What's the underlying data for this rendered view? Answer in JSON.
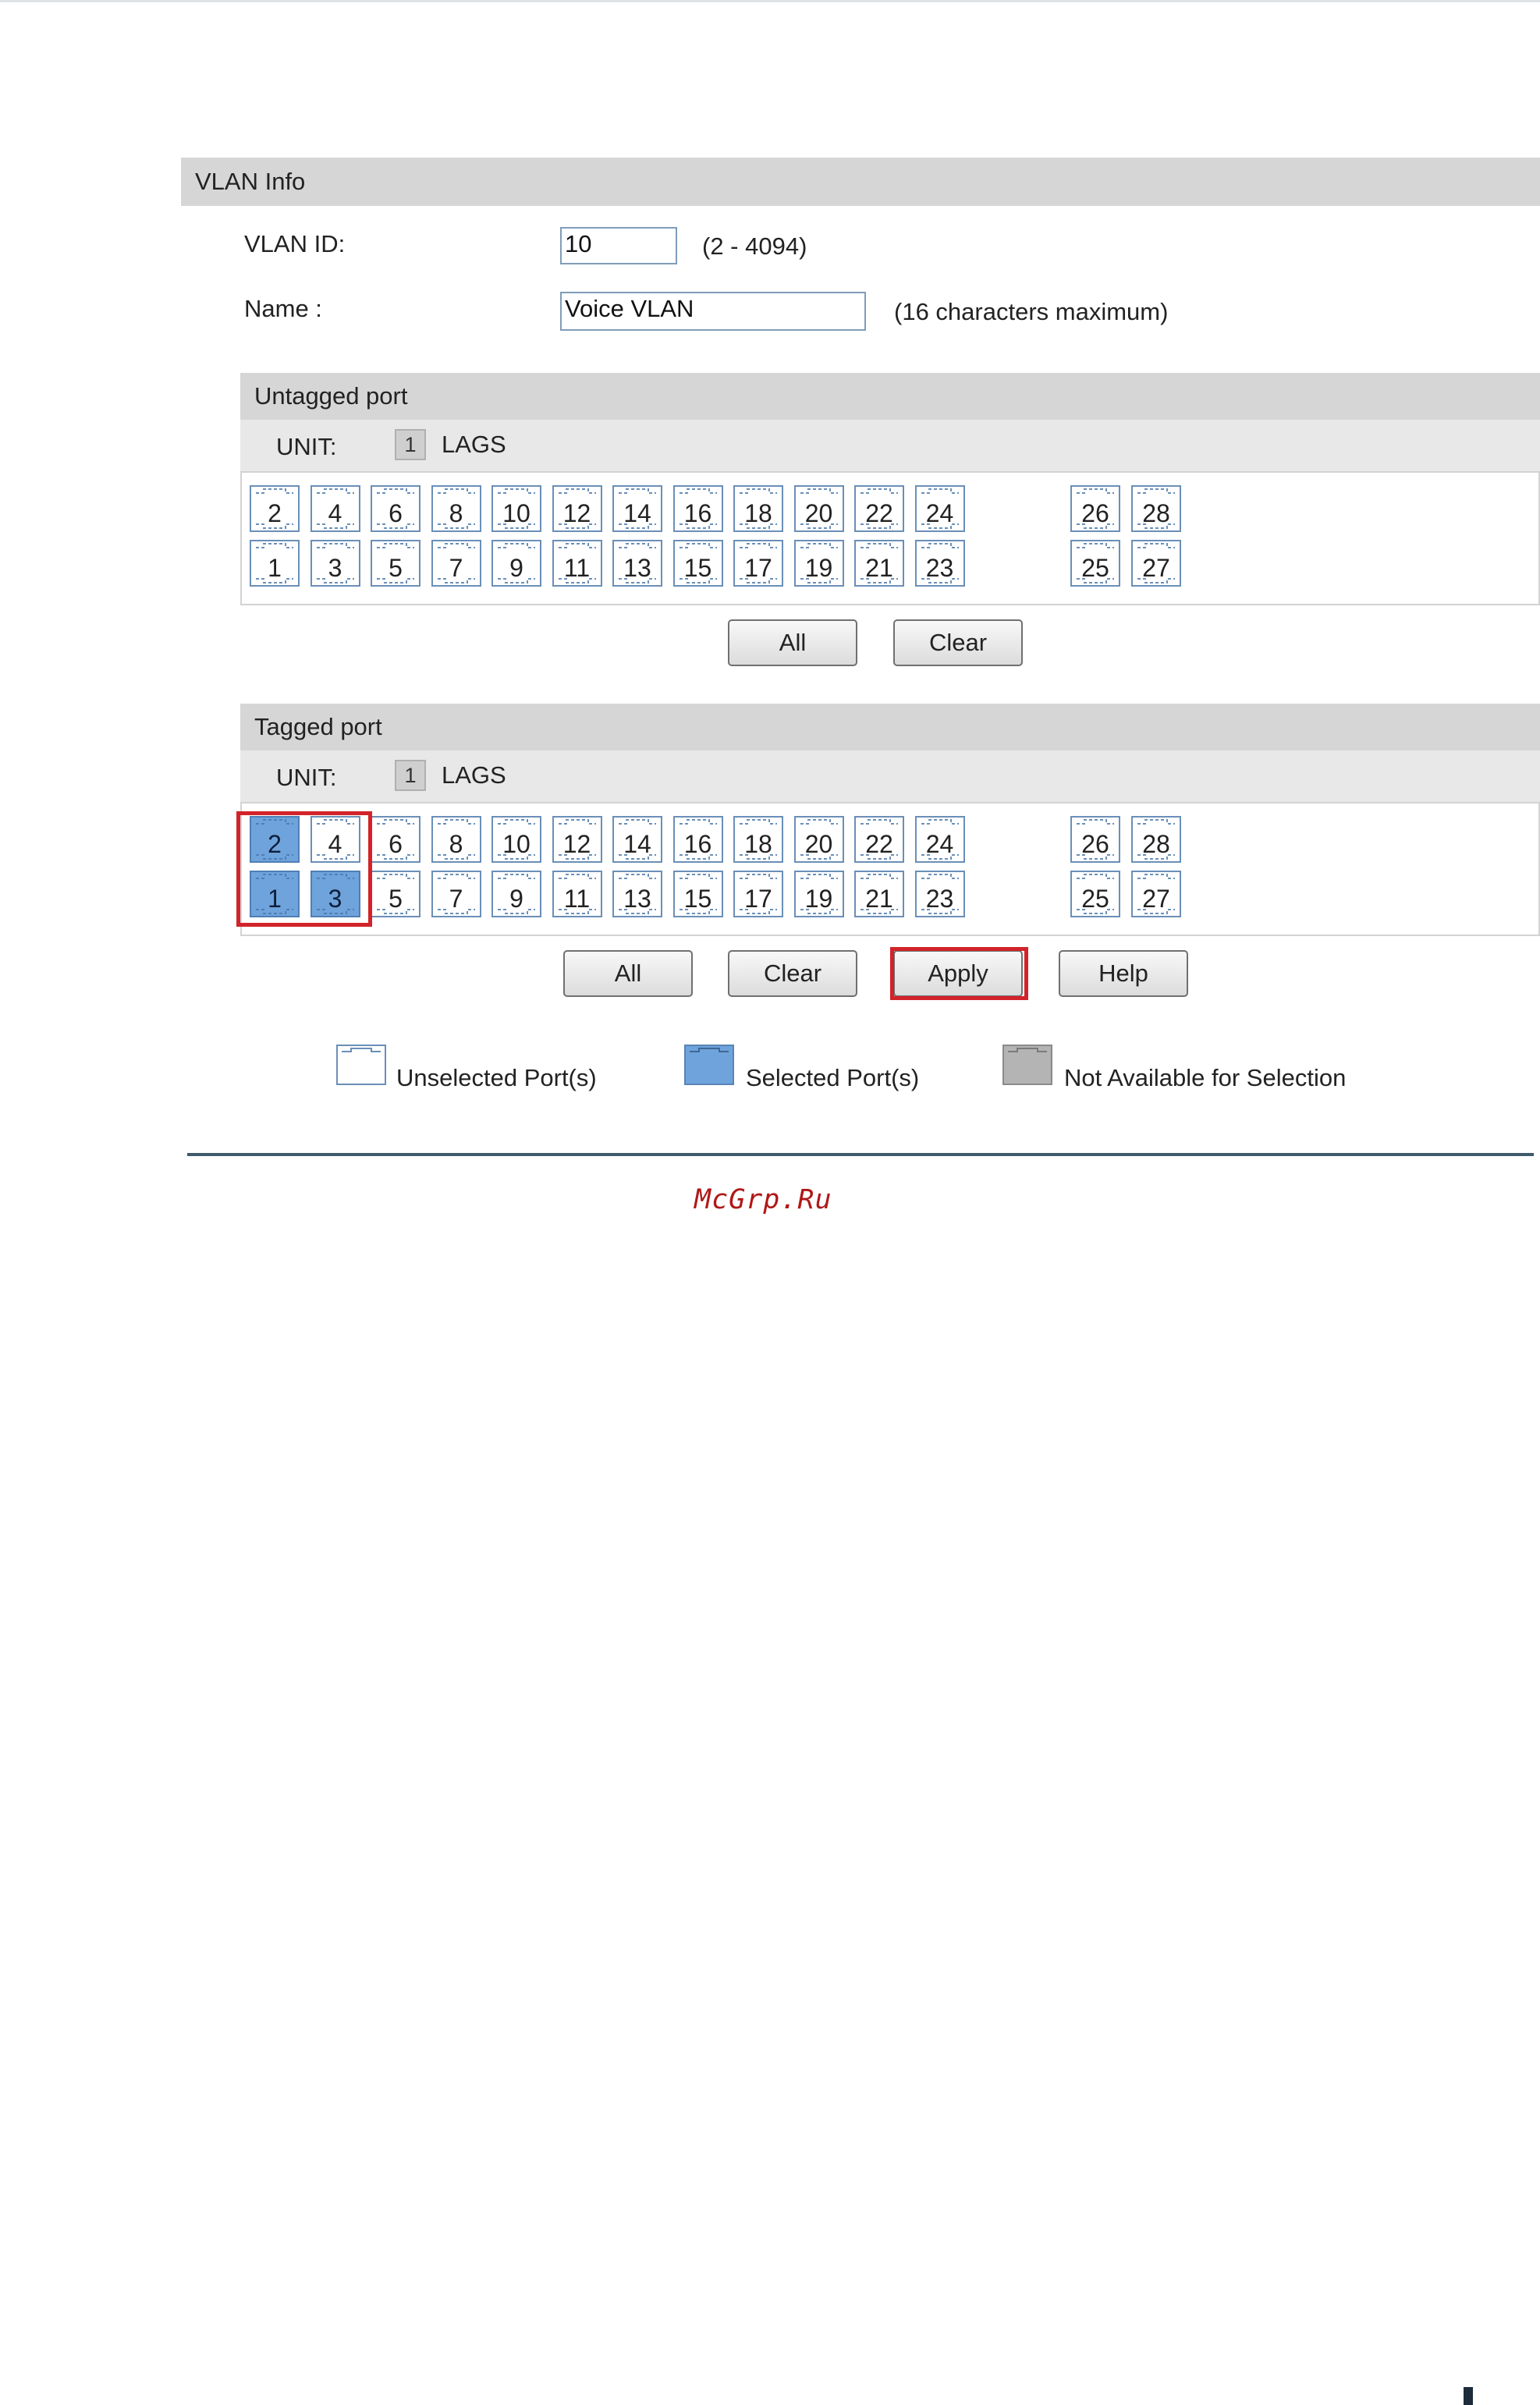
{
  "section_title": "VLAN Info",
  "vlan_id": {
    "label": "VLAN ID:",
    "value": "10",
    "hint": "(2 - 4094)"
  },
  "name": {
    "label": "Name :",
    "value": "Voice VLAN",
    "hint": "(16 characters maximum)"
  },
  "untagged": {
    "title": "Untagged port",
    "unit_label": "UNIT:",
    "unit_number": "1",
    "lags_label": "LAGS",
    "top_row": [
      "2",
      "4",
      "6",
      "8",
      "10",
      "12",
      "14",
      "16",
      "18",
      "20",
      "22",
      "24"
    ],
    "bottom_row": [
      "1",
      "3",
      "5",
      "7",
      "9",
      "11",
      "13",
      "15",
      "17",
      "19",
      "21",
      "23"
    ],
    "sfp_top": [
      "26",
      "28"
    ],
    "sfp_bottom": [
      "25",
      "27"
    ],
    "selected": [],
    "buttons": {
      "all": "All",
      "clear": "Clear"
    }
  },
  "tagged": {
    "title": "Tagged port",
    "unit_label": "UNIT:",
    "unit_number": "1",
    "lags_label": "LAGS",
    "top_row": [
      "2",
      "4",
      "6",
      "8",
      "10",
      "12",
      "14",
      "16",
      "18",
      "20",
      "22",
      "24"
    ],
    "bottom_row": [
      "1",
      "3",
      "5",
      "7",
      "9",
      "11",
      "13",
      "15",
      "17",
      "19",
      "21",
      "23"
    ],
    "sfp_top": [
      "26",
      "28"
    ],
    "sfp_bottom": [
      "25",
      "27"
    ],
    "selected": [
      "1",
      "2",
      "3"
    ],
    "buttons": {
      "all": "All",
      "clear": "Clear",
      "apply": "Apply",
      "help": "Help"
    }
  },
  "legend": {
    "unselected": "Unselected Port(s)",
    "selected": "Selected Port(s)",
    "not_available": "Not Available for Selection"
  },
  "colors": {
    "selected_port": "#6fa3dc",
    "unselected_port_border": "#6a8fb8",
    "not_available": "#b4b4b4",
    "highlight": "#d2232a"
  },
  "watermark": "McGrp.Ru"
}
